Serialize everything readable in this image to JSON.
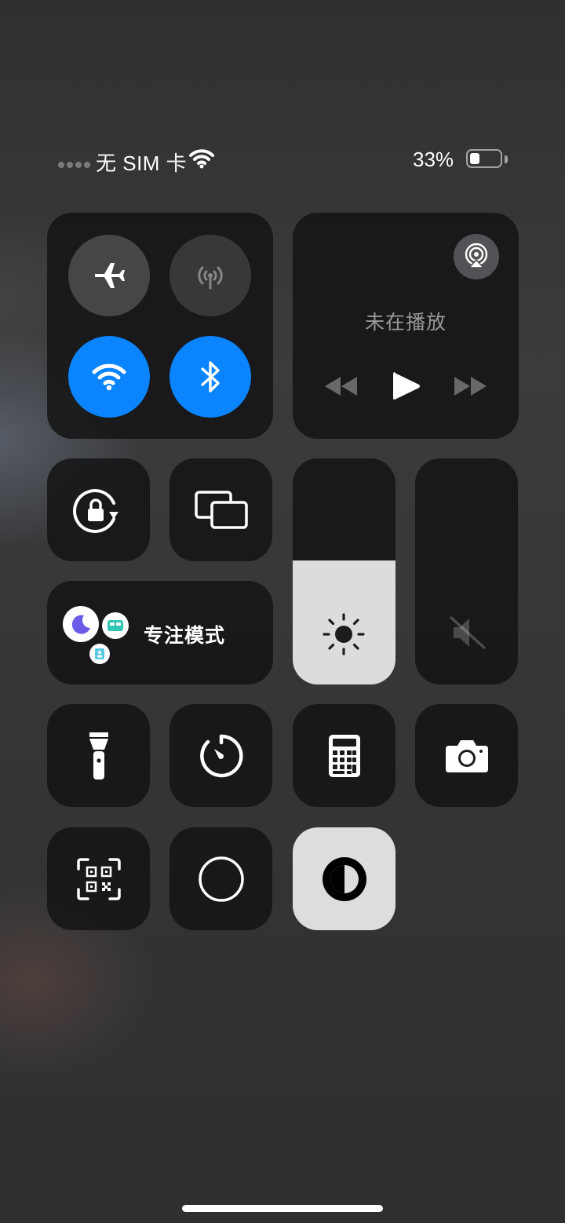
{
  "status_bar": {
    "carrier": "无 SIM 卡",
    "battery_percent_label": "33%",
    "battery_level": 0.33,
    "signal_icon": "signal-dots-icon",
    "wifi_icon": "wifi-icon"
  },
  "connectivity": {
    "airplane": {
      "icon": "airplane-icon",
      "on": false
    },
    "cellular": {
      "icon": "cellular-antenna-icon",
      "on": false
    },
    "wifi": {
      "icon": "wifi-icon",
      "on": true
    },
    "bluetooth": {
      "icon": "bluetooth-icon",
      "on": true
    }
  },
  "now_playing": {
    "label": "未在播放",
    "airplay_icon": "airplay-audio-icon",
    "controls": [
      "rewind-icon",
      "play-icon",
      "fast-forward-icon"
    ]
  },
  "focus": {
    "label": "专注模式"
  },
  "sliders": {
    "brightness": {
      "icon": "sun-icon",
      "level": 0.55
    },
    "volume": {
      "icon": "speaker-muted-icon",
      "level": 0.0
    }
  },
  "tiles": [
    "orientation-lock-icon",
    "screen-mirroring-icon",
    "flashlight-icon",
    "timer-icon",
    "calculator-icon",
    "camera-icon",
    "qr-scanner-icon",
    "screen-record-icon",
    "dark-mode-icon"
  ],
  "colors": {
    "accent": "#0a84ff",
    "tile": "#121214",
    "light_tile": "#dddde0"
  }
}
